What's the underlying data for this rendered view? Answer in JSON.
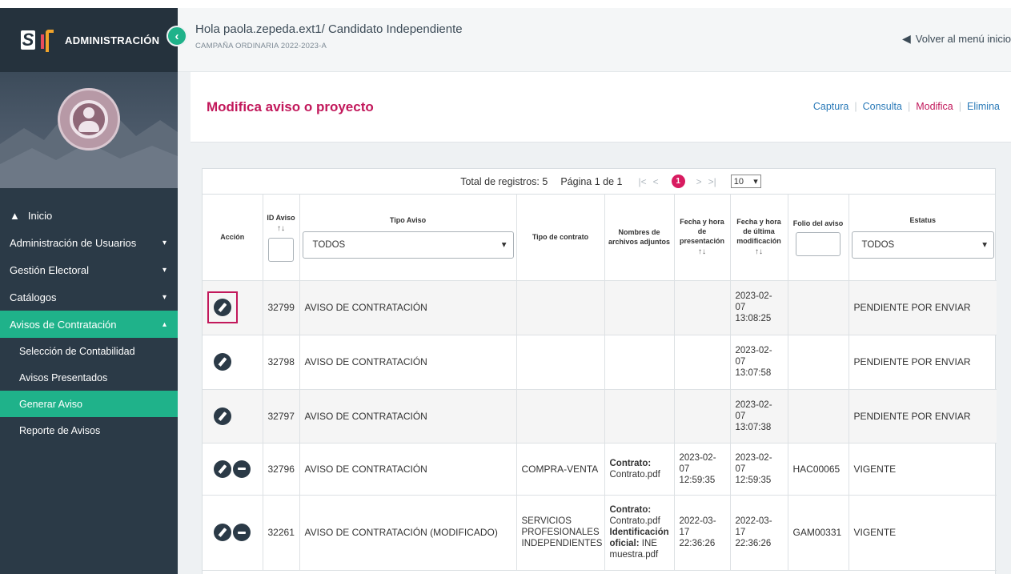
{
  "sidebar": {
    "app_title": "ADMINISTRACIÓN",
    "nav": [
      {
        "label": "Inicio"
      },
      {
        "label": "Administración de Usuarios"
      },
      {
        "label": "Gestión Electoral"
      },
      {
        "label": "Catálogos"
      },
      {
        "label": "Avisos de Contratación"
      }
    ],
    "sub": [
      {
        "label": "Selección de Contabilidad"
      },
      {
        "label": "Avisos Presentados"
      },
      {
        "label": "Generar Aviso"
      },
      {
        "label": "Reporte de Avisos"
      }
    ]
  },
  "header": {
    "greeting": "Hola paola.zepeda.ext1/ Candidato Independiente",
    "campaign": "CAMPAÑA ORDINARIA 2022-2023-A",
    "back_link": "Volver al menú inicio"
  },
  "page": {
    "title": "Modifica aviso o proyecto",
    "tabs": [
      "Captura",
      "Consulta",
      "Modifica",
      "Elimina"
    ]
  },
  "pager": {
    "total_label": "Total de registros: 5",
    "page_label": "Página 1 de 1",
    "first": "|<",
    "prev": "<",
    "current": "1",
    "next": ">",
    "last": ">|",
    "page_size": "10"
  },
  "table": {
    "headers": {
      "accion": "Acción",
      "id": "ID Aviso",
      "tipo": "Tipo Aviso",
      "tipo_select": "TODOS",
      "contrato": "Tipo de contrato",
      "archivos": "Nombres de archivos adjuntos",
      "fecha_pres": "Fecha y hora de presentación",
      "fecha_mod": "Fecha y hora de última modificación",
      "folio": "Folio del aviso",
      "estatus": "Estatus",
      "estatus_select": "TODOS"
    },
    "rows": [
      {
        "id": "32799",
        "tipo": "AVISO DE CONTRATACIÓN",
        "contrato": "",
        "archivos": "",
        "fp1": "",
        "fp2": "",
        "fp3": "",
        "fm1": "2023-02-",
        "fm2": "07",
        "fm3": "13:08:25",
        "folio": "",
        "estatus": "PENDIENTE POR ENVIAR"
      },
      {
        "id": "32798",
        "tipo": "AVISO DE CONTRATACIÓN",
        "contrato": "",
        "archivos": "",
        "fp1": "",
        "fp2": "",
        "fp3": "",
        "fm1": "2023-02-",
        "fm2": "07",
        "fm3": "13:07:58",
        "folio": "",
        "estatus": "PENDIENTE POR ENVIAR"
      },
      {
        "id": "32797",
        "tipo": "AVISO DE CONTRATACIÓN",
        "contrato": "",
        "archivos": "",
        "fp1": "",
        "fp2": "",
        "fp3": "",
        "fm1": "2023-02-",
        "fm2": "07",
        "fm3": "13:07:38",
        "folio": "",
        "estatus": "PENDIENTE POR ENVIAR"
      },
      {
        "id": "32796",
        "tipo": "AVISO DE CONTRATACIÓN",
        "contrato": "COMPRA-VENTA",
        "a1b": "Contrato:",
        "a1": "Contrato.pdf",
        "fp1": "2023-02-",
        "fp2": "07",
        "fp3": "12:59:35",
        "fm1": "2023-02-",
        "fm2": "07",
        "fm3": "12:59:35",
        "folio": "HAC00065",
        "estatus": "VIGENTE"
      },
      {
        "id": "32261",
        "tipo": "AVISO DE CONTRATACIÓN (MODIFICADO)",
        "contrato": "SERVICIOS PROFESIONALES INDEPENDIENTES",
        "a1b": "Contrato:",
        "a1": "Contrato.pdf",
        "a2b": "Identificación oficial:",
        "a2": "INE muestra.pdf",
        "fp1": "2022-03-",
        "fp2": "17",
        "fp3": "22:36:26",
        "fm1": "2022-03-",
        "fm2": "17",
        "fm3": "22:36:26",
        "folio": "GAM00331",
        "estatus": "VIGENTE"
      }
    ]
  },
  "colors": {
    "accent": "#1fb28a",
    "brand": "#c2185b",
    "sidebar": "#2b3a47",
    "link": "#2a7ab8"
  },
  "icons": [
    "logo-icon",
    "chevron-left-icon",
    "home-icon",
    "chevron-down-icon",
    "chevron-up-icon",
    "back-arrow-icon",
    "edit-icon",
    "delete-icon",
    "sort-icon"
  ]
}
